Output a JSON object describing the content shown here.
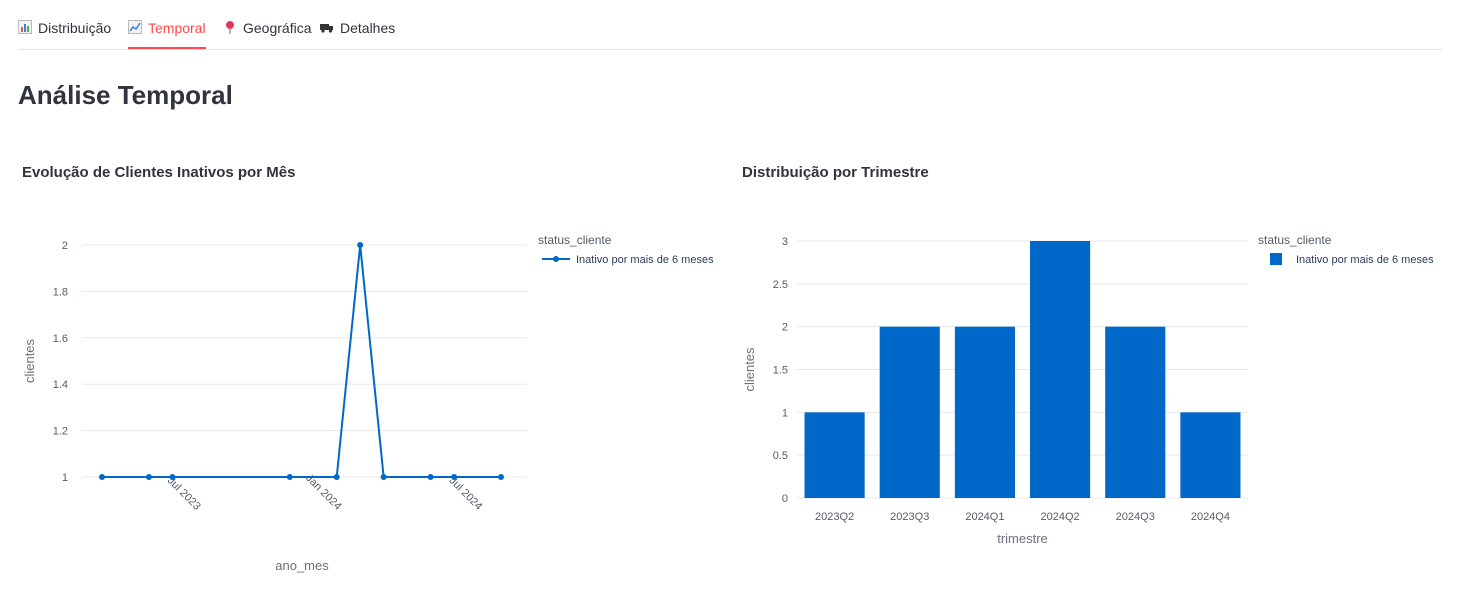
{
  "tabs": [
    {
      "label": "Distribuição",
      "icon": "bar-chart-icon",
      "active": false
    },
    {
      "label": "Temporal",
      "icon": "line-chart-icon",
      "active": true
    },
    {
      "label": "Geográfica",
      "icon": "pin-icon",
      "active": false
    },
    {
      "label": "Detalhes",
      "icon": "truck-icon",
      "active": false
    }
  ],
  "page_title": "Análise Temporal",
  "colors": {
    "accent": "#ff4b4b",
    "series": "#0068c9",
    "grid": "#e8e8ec",
    "text": "#31333f"
  },
  "chart_data": [
    {
      "type": "line",
      "title": "Evolução de Clientes Inativos por Mês",
      "xlabel": "ano_mes",
      "ylabel": "clientes",
      "x_ticks": [
        "Jul 2023",
        "Jan 2024",
        "Jul 2024"
      ],
      "y_ticks": [
        "1",
        "1.2",
        "1.4",
        "1.6",
        "1.8",
        "2"
      ],
      "ylim": [
        1,
        2
      ],
      "legend_title": "status_cliente",
      "legend_position": "top-right",
      "grid": true,
      "series": [
        {
          "name": "Inativo por mais de 6 meses",
          "x": [
            "2023-04",
            "2023-06",
            "2023-07",
            "2023-12",
            "2024-02",
            "2024-03",
            "2024-04",
            "2024-06",
            "2024-07",
            "2024-09"
          ],
          "y": [
            1,
            1,
            1,
            1,
            1,
            2,
            1,
            1,
            1,
            1
          ]
        }
      ]
    },
    {
      "type": "bar",
      "title": "Distribuição por Trimestre",
      "xlabel": "trimestre",
      "ylabel": "clientes",
      "categories": [
        "2023Q2",
        "2023Q3",
        "2024Q1",
        "2024Q2",
        "2024Q3",
        "2024Q4"
      ],
      "y_ticks": [
        "0",
        "0.5",
        "1",
        "1.5",
        "2",
        "2.5",
        "3"
      ],
      "ylim": [
        0,
        3
      ],
      "legend_title": "status_cliente",
      "legend_position": "top-right",
      "grid": true,
      "series": [
        {
          "name": "Inativo por mais de 6 meses",
          "values": [
            1,
            2,
            2,
            3,
            2,
            1
          ]
        }
      ]
    }
  ]
}
